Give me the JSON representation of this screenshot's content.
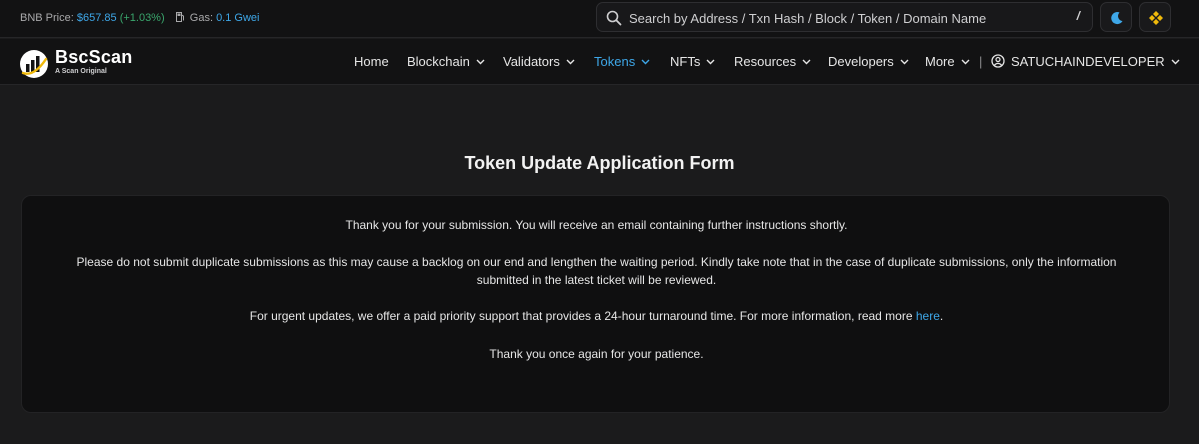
{
  "topbar": {
    "price_label": "BNB Price:",
    "price_value": "$657.85",
    "price_change": "(+1.03%)",
    "gas_label": "Gas:",
    "gas_value": "0.1 Gwei",
    "search_placeholder": "Search by Address / Txn Hash / Block / Token / Domain Name",
    "search_shortcut": "/"
  },
  "brand": {
    "name": "BscScan",
    "tagline": "A Scan Original"
  },
  "nav": {
    "items": [
      {
        "label": "Home"
      },
      {
        "label": "Blockchain"
      },
      {
        "label": "Validators"
      },
      {
        "label": "Tokens"
      },
      {
        "label": "NFTs"
      },
      {
        "label": "Resources"
      },
      {
        "label": "Developers"
      },
      {
        "label": "More"
      }
    ],
    "separator": "|",
    "user": "SATUCHAINDEVELOPER"
  },
  "main": {
    "title": "Token Update Application Form",
    "message_1": "Thank you for your submission. You will receive an email containing further instructions shortly.",
    "message_2": "Please do not submit duplicate submissions as this may cause a backlog on our end and lengthen the waiting period. Kindly take note that in the case of duplicate submissions, only the information submitted in the latest ticket will be reviewed.",
    "message_3": "For urgent updates, we offer a paid priority support that provides a 24-hour turnaround time. For more information, read more",
    "message_3_link": "here",
    "message_3_end": ".",
    "message_4": "Thank you once again for your patience."
  },
  "colors": {
    "accent": "#3ea7e8",
    "positive": "#3aa76d",
    "background": "#1b1b1c",
    "card": "#0f0f10",
    "bnb": "#f0b90b"
  },
  "icons": [
    "gas-pump-icon",
    "search-icon",
    "moon-icon",
    "bnb-icon",
    "bscscan-logo",
    "chevron-down-icon",
    "user-circle-icon"
  ]
}
